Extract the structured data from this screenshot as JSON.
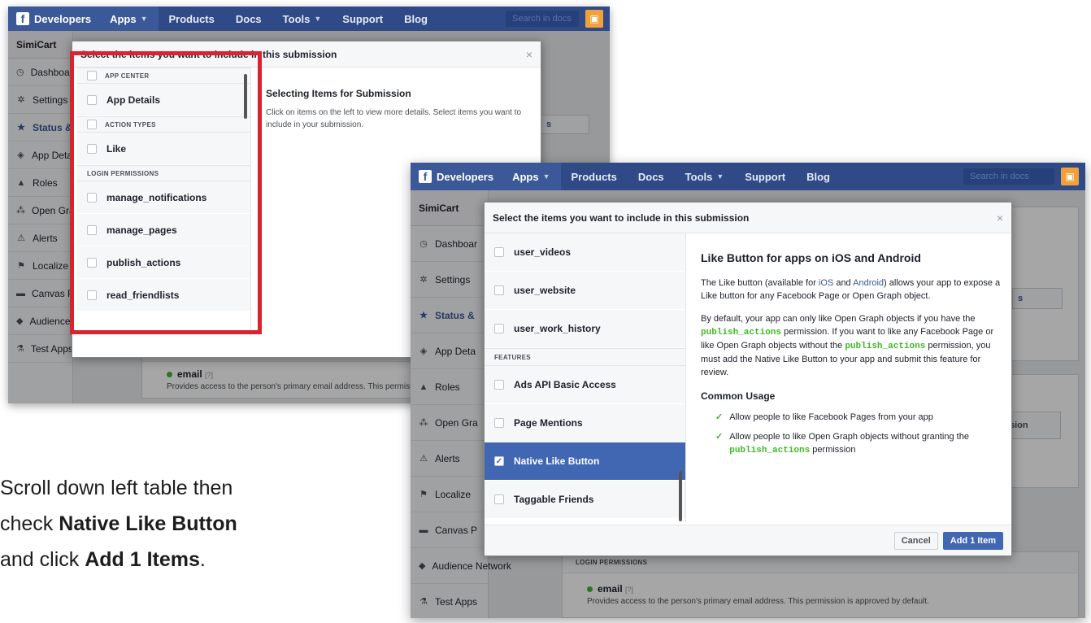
{
  "nav": {
    "brand": "Developers",
    "items": [
      "Apps",
      "Products",
      "Docs",
      "Tools",
      "Support",
      "Blog"
    ],
    "search_placeholder": "Search in docs"
  },
  "sidebar": {
    "app_name": "SimiCart",
    "items_shot1": [
      "Dashboard",
      "Settings",
      "Status &",
      "App Deta",
      "Roles",
      "Open Gra",
      "Alerts",
      "Localize",
      "Canvas P",
      "Audience Network",
      "Test Apps"
    ],
    "items_shot2": [
      "Dashboar",
      "Settings",
      "Status &",
      "App Deta",
      "Roles",
      "Open Gra",
      "Alerts",
      "Localize",
      "Canvas P",
      "Audience Network",
      "Test Apps"
    ]
  },
  "bg": {
    "login_permissions": "LOGIN PERMISSIONS",
    "email": "email",
    "email_help": "[?]",
    "email_desc1": "Provides access to the person's primary email address. This permiss",
    "email_desc2": "Provides access to the person's primary email address. This permission is approved by default.",
    "tab_fragment": "s",
    "btn_fragment": "sion"
  },
  "modal1": {
    "title": "Select the items you want to include in this submission",
    "close": "×",
    "list": [
      {
        "type": "head",
        "label": "APP CENTER",
        "checkbox": true
      },
      {
        "type": "item",
        "label": "App Details"
      },
      {
        "type": "head",
        "label": "ACTION TYPES",
        "checkbox": true
      },
      {
        "type": "item",
        "label": "Like"
      },
      {
        "type": "head",
        "label": "LOGIN PERMISSIONS",
        "checkbox": false
      },
      {
        "type": "item",
        "label": "manage_notifications"
      },
      {
        "type": "item",
        "label": "manage_pages"
      },
      {
        "type": "item",
        "label": "publish_actions"
      },
      {
        "type": "item",
        "label": "read_friendlists"
      }
    ],
    "detail_title": "Selecting Items for Submission",
    "detail_text": "Click on items on the left to view more details. Select items you want to include in your submission."
  },
  "modal2": {
    "title": "Select the items you want to include in this submission",
    "close": "×",
    "list": [
      {
        "type": "item",
        "label": "user_videos"
      },
      {
        "type": "item",
        "label": "user_website"
      },
      {
        "type": "item",
        "label": "user_work_history"
      },
      {
        "type": "head",
        "label": "FEATURES",
        "checkbox": false
      },
      {
        "type": "item",
        "label": "Ads API Basic Access"
      },
      {
        "type": "item",
        "label": "Page Mentions"
      },
      {
        "type": "item",
        "label": "Native Like Button",
        "selected": true
      },
      {
        "type": "item",
        "label": "Taggable Friends"
      }
    ],
    "detail_title": "Like Button for apps on iOS and Android",
    "p1_a": "The Like button (available for ",
    "p1_ios": "iOS",
    "p1_and": " and ",
    "p1_android": "Android",
    "p1_b": ") allows your app to expose a Like button for any Facebook Page or Open Graph object.",
    "p2_a": "By default, your app can only like Open Graph objects if you have the ",
    "p2_code1": "publish_actions",
    "p2_b": " permission. If you want to like any Facebook Page or like Open Graph objects without the ",
    "p2_code2": "publish_actions",
    "p2_c": " permission, you must add the Native Like Button to your app and submit this feature for review.",
    "usage_title": "Common Usage",
    "usage1": "Allow people to like Facebook Pages from your app",
    "usage2_a": "Allow people to like Open Graph objects without granting the ",
    "usage2_code": "publish_actions",
    "usage2_b": " permission",
    "cancel": "Cancel",
    "add": "Add 1 Item"
  },
  "caption": {
    "line1": "Scroll down left table then",
    "line2_a": "check ",
    "line2_b": "Native Like Button",
    "line3_a": "and click ",
    "line3_b": "Add 1 Items",
    "line3_c": "."
  },
  "colors": {
    "nav": "#2f4a87",
    "selected": "#4267b2",
    "highlight": "#d9232e",
    "code": "#42b72a"
  }
}
